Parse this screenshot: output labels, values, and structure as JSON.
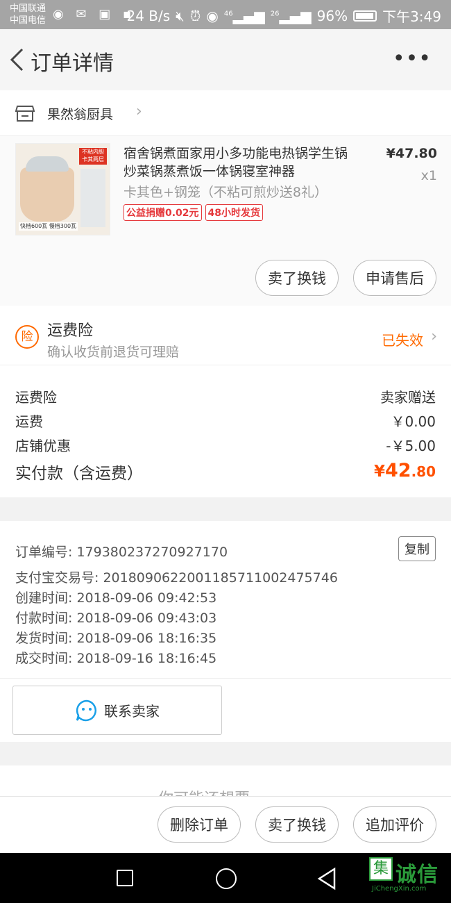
{
  "status_bar": {
    "carrier1": "中国联通",
    "carrier2": "中国电信",
    "speed": "24 B/s",
    "signal1": "46",
    "signal2": "26",
    "battery": "96%",
    "time": "下午3:49"
  },
  "nav": {
    "title": "订单详情"
  },
  "shop": {
    "name": "果然翁厨具"
  },
  "product": {
    "title": "宿舍锅煮面家用小多功能电热锅学生锅炒菜锅蒸煮饭一体锅寝室神器",
    "sku": "卡其色+钢笼（不粘可煎炒送8礼）",
    "price": "¥47.80",
    "qty": "x1",
    "tags": [
      "公益捐赠0.02元",
      "48小时发货"
    ],
    "thumb_tag": "不粘内胆 卡其两层",
    "thumb_spec": "快档600瓦 慢档300瓦",
    "actions": [
      "卖了换钱",
      "申请售后"
    ]
  },
  "insurance": {
    "icon_char": "险",
    "title": "运费险",
    "subtitle": "确认收货前退货可理赔",
    "status": "已失效"
  },
  "fees": {
    "rows": [
      {
        "label": "运费险",
        "value": "卖家赠送"
      },
      {
        "label": "运费",
        "value": "￥0.00"
      },
      {
        "label": "店铺优惠",
        "value": "-￥5.00"
      }
    ],
    "total_label": "实付款（含运费）",
    "total_symbol": "¥",
    "total_int": "42",
    "total_dec": ".80"
  },
  "order_info": {
    "lines": [
      "订单编号: 179380237270927170",
      "支付宝交易号: 2018090622001185711002475746",
      "创建时间: 2018-09-06 09:42:53",
      "付款时间: 2018-09-06 09:43:03",
      "发货时间: 2018-09-06 18:16:35",
      "成交时间: 2018-09-16 18:16:45"
    ],
    "copy_label": "复制",
    "contact_label": "联系卖家"
  },
  "peek": {
    "text": "你可能还想要"
  },
  "bottom_actions": [
    "删除订单",
    "卖了换钱",
    "追加评价"
  ],
  "watermark": {
    "logo": "集",
    "text": "诚信",
    "url": "JiChengXin.com"
  },
  "colors": {
    "accent": "#ff5000",
    "orange": "#ff6a00",
    "tag_red": "#e5383b"
  }
}
